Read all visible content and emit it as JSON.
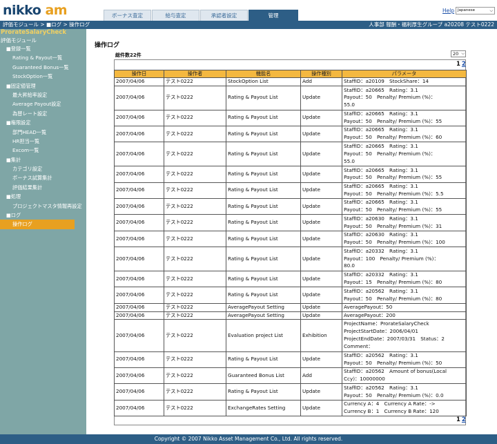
{
  "header": {
    "logo_part1": "nikko",
    "logo_part2": "am",
    "tabs": [
      {
        "label": "ボーナス査定"
      },
      {
        "label": "給与査定"
      },
      {
        "label": "承認者設定"
      },
      {
        "label": "管理"
      }
    ],
    "help_label": "Help",
    "language": "Japanese"
  },
  "topbar": {
    "breadcrumb": "評価モジュール > ■ログ > 操作ログ",
    "user": "人事部 報酬・福利厚生グループ a20208 テスト0222"
  },
  "sidebar": {
    "app_title": "ProrateSalaryCheck",
    "module": "評価モジュール",
    "items": [
      {
        "label": "■登録一覧",
        "kind": "sec"
      },
      {
        "label": "Rating & Payout一覧",
        "kind": "lnk"
      },
      {
        "label": "Guaranteed Bonus一覧",
        "kind": "lnk"
      },
      {
        "label": "StockOption一覧",
        "kind": "lnk"
      },
      {
        "label": "■固定値管理",
        "kind": "sec"
      },
      {
        "label": "最大昇給率設定",
        "kind": "lnk"
      },
      {
        "label": "Average Payout設定",
        "kind": "lnk"
      },
      {
        "label": "為替レート設定",
        "kind": "lnk"
      },
      {
        "label": "■権限設定",
        "kind": "sec"
      },
      {
        "label": "部門HEAD一覧",
        "kind": "lnk"
      },
      {
        "label": "HR担当一覧",
        "kind": "lnk"
      },
      {
        "label": "Excom一覧",
        "kind": "lnk"
      },
      {
        "label": "■集計",
        "kind": "sec"
      },
      {
        "label": "カテゴリ設定",
        "kind": "lnk"
      },
      {
        "label": "ボーナス試算集計",
        "kind": "lnk"
      },
      {
        "label": "評価結果集計",
        "kind": "lnk"
      },
      {
        "label": "■処理",
        "kind": "sec"
      },
      {
        "label": "プロジェクトマスタ情報再設定",
        "kind": "lnk"
      },
      {
        "label": "■ログ",
        "kind": "sec"
      },
      {
        "label": "操作ログ",
        "kind": "lnk",
        "selected": true
      }
    ]
  },
  "main": {
    "title": "操作ログ",
    "count_label": "総件数22件",
    "per_page": "20",
    "pager": {
      "current": "1",
      "next": "2"
    },
    "columns": [
      "操作日",
      "操作者",
      "機能名",
      "操作種別",
      "パラメータ"
    ],
    "rows": [
      {
        "date": "2007/04/06",
        "user": "テスト0222",
        "func": "StockOption List",
        "op": "Add",
        "params": [
          "StaffID：a20109　StockShare：14"
        ]
      },
      {
        "date": "2007/04/06",
        "user": "テスト0222",
        "func": "Rating & Payout List",
        "op": "Update",
        "params": [
          "StaffID：a20665　Rating：3.1",
          "Payout：50　Penalty/ Premium (%)：",
          "55.0"
        ]
      },
      {
        "date": "2007/04/06",
        "user": "テスト0222",
        "func": "Rating & Payout List",
        "op": "Update",
        "params": [
          "StaffID：a20665　Rating：3.1",
          "Payout：50　Penalty/ Premium (%)：55"
        ]
      },
      {
        "date": "2007/04/06",
        "user": "テスト0222",
        "func": "Rating & Payout List",
        "op": "Update",
        "params": [
          "StaffID：a20665　Rating：3.1",
          "Payout：50　Penalty/ Premium (%)：60"
        ]
      },
      {
        "date": "2007/04/06",
        "user": "テスト0222",
        "func": "Rating & Payout List",
        "op": "Update",
        "params": [
          "StaffID：a20665　Rating：3.1",
          "Payout：50　Penalty/ Premium (%)：",
          "55.0"
        ]
      },
      {
        "date": "2007/04/06",
        "user": "テスト0222",
        "func": "Rating & Payout List",
        "op": "Update",
        "params": [
          "StaffID：a20665　Rating：3.1",
          "Payout：50　Penalty/ Premium (%)：55"
        ]
      },
      {
        "date": "2007/04/06",
        "user": "テスト0222",
        "func": "Rating & Payout List",
        "op": "Update",
        "params": [
          "StaffID：a20665　Rating：3.1",
          "Payout：50　Penalty/ Premium (%)：5.5"
        ]
      },
      {
        "date": "2007/04/06",
        "user": "テスト0222",
        "func": "Rating & Payout List",
        "op": "Update",
        "params": [
          "StaffID：a20665　Rating：3.1",
          "Payout：50　Penalty/ Premium (%)：55"
        ]
      },
      {
        "date": "2007/04/06",
        "user": "テスト0222",
        "func": "Rating & Payout List",
        "op": "Update",
        "params": [
          "StaffID：a20630　Rating：3.1",
          "Payout：50　Penalty/ Premium (%)：31"
        ]
      },
      {
        "date": "2007/04/06",
        "user": "テスト0222",
        "func": "Rating & Payout List",
        "op": "Update",
        "params": [
          "StaffID：a20630　Rating：3.1",
          "Payout：50　Penalty/ Premium (%)：100"
        ]
      },
      {
        "date": "2007/04/06",
        "user": "テスト0222",
        "func": "Rating & Payout List",
        "op": "Update",
        "params": [
          "StaffID：a20332　Rating：3.1",
          "Payout：100　Penalty/ Premium (%)：",
          "80.0"
        ]
      },
      {
        "date": "2007/04/06",
        "user": "テスト0222",
        "func": "Rating & Payout List",
        "op": "Update",
        "params": [
          "StaffID：a20332　Rating：3.1",
          "Payout：15　Penalty/ Premium (%)：80"
        ]
      },
      {
        "date": "2007/04/06",
        "user": "テスト0222",
        "func": "Rating & Payout List",
        "op": "Update",
        "params": [
          "StaffID：a20562　Rating：3.1",
          "Payout：50　Penalty/ Premium (%)：80"
        ]
      },
      {
        "date": "2007/04/06",
        "user": "テスト0222",
        "func": "AveragePayout Setting",
        "op": "Update",
        "params": [
          "AveragePayout：50"
        ]
      },
      {
        "date": "2007/04/06",
        "user": "テスト0222",
        "func": "AveragePayout Setting",
        "op": "Update",
        "params": [
          "AveragePayout：200"
        ]
      },
      {
        "date": "2007/04/06",
        "user": "テスト0222",
        "func": "Evaluation project List",
        "op": "Exhibition",
        "params": [
          "ProjectName：ProrateSalaryCheck",
          "ProjectStartDate：2006/04/01",
          "ProjectEndDate：2007/03/31　Status：2",
          "Comment："
        ]
      },
      {
        "date": "2007/04/06",
        "user": "テスト0222",
        "func": "Rating & Payout List",
        "op": "Update",
        "params": [
          "StaffID：a20562　Rating：3.1",
          "Payout：50　Penalty/ Premium (%)：50"
        ]
      },
      {
        "date": "2007/04/06",
        "user": "テスト0222",
        "func": "Guaranteed Bonus List",
        "op": "Add",
        "params": [
          "StaffID：a20562　Amount of bonus(Local",
          "Ccy)：10000000"
        ]
      },
      {
        "date": "2007/04/06",
        "user": "テスト0222",
        "func": "Rating & Payout List",
        "op": "Update",
        "params": [
          "StaffID：a20562　Rating：3.1",
          "Payout：50　Penalty/ Premium (%)：0.0"
        ]
      },
      {
        "date": "2007/04/06",
        "user": "テスト0222",
        "func": "ExchangeRates Setting",
        "op": "Update",
        "params": [
          "Currency A：4　Currency A Rate：->",
          "Currency B：1　Currency B Rate：120"
        ]
      }
    ]
  },
  "footer": {
    "copyright": "Copyright © 2007 Nikko Asset Management Co., Ltd. All rights reserved."
  }
}
